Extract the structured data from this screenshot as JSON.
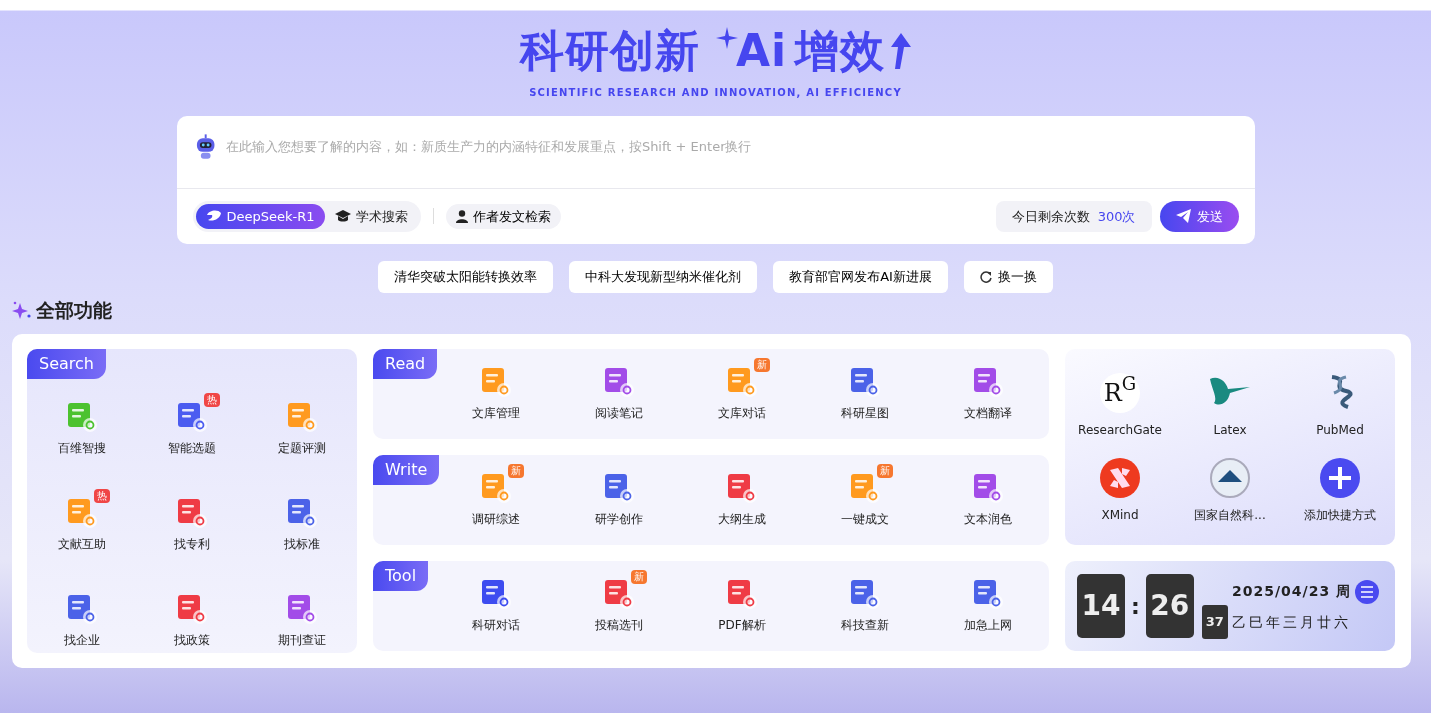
{
  "hero": {
    "title": "科研创新",
    "title_ai": "Ai",
    "title_end": "增效",
    "subtitle": "SCIENTIFIC RESEARCH AND INNOVATION, AI EFFICIENCY"
  },
  "search": {
    "placeholder": "在此输入您想要了解的内容，如：新质生产力的内涵特征和发展重点，按Shift + Enter换行",
    "modes": [
      {
        "label": "DeepSeek-R1",
        "selected": true,
        "kind": "model"
      },
      {
        "label": "学术搜索",
        "selected": false,
        "kind": "cap"
      }
    ],
    "author_search": "作者发文检索",
    "quota_label": "今日剩余次数",
    "quota_value": "300次",
    "send": "发送"
  },
  "suggestions": [
    {
      "label": "清华突破太阳能转换效率",
      "kind": "topic"
    },
    {
      "label": "中科大发现新型纳米催化剂",
      "kind": "topic"
    },
    {
      "label": "教育部官网发布AI新进展",
      "kind": "topic"
    },
    {
      "label": "换一换",
      "kind": "refresh"
    }
  ],
  "section_title": "全部功能",
  "search_group": {
    "title": "Search",
    "items": [
      {
        "label": "百维智搜",
        "color": "#4cc22f"
      },
      {
        "label": "智能选题",
        "color": "#4b5cf0",
        "badge": "热"
      },
      {
        "label": "定题评测",
        "color": "#ff9a1f"
      },
      {
        "label": "文献互助",
        "color": "#ff9a1f",
        "badge": "热"
      },
      {
        "label": "找专利",
        "color": "#ef3b45"
      },
      {
        "label": "找标准",
        "color": "#4b62e8"
      },
      {
        "label": "找企业",
        "color": "#4b62e8"
      },
      {
        "label": "找政策",
        "color": "#ef3b45"
      },
      {
        "label": "期刊查证",
        "color": "#a24ce8"
      }
    ]
  },
  "groups": [
    {
      "title": "Read",
      "items": [
        {
          "label": "文库管理",
          "color": "#ff9a1f"
        },
        {
          "label": "阅读笔记",
          "color": "#a24ce8"
        },
        {
          "label": "文库对话",
          "color": "#ff9a1f",
          "badge": "新"
        },
        {
          "label": "科研星图",
          "color": "#4b62e8"
        },
        {
          "label": "文档翻译",
          "color": "#a24ce8"
        }
      ]
    },
    {
      "title": "Write",
      "items": [
        {
          "label": "调研综述",
          "color": "#ff9a1f",
          "badge": "新"
        },
        {
          "label": "研学创作",
          "color": "#4b62e8"
        },
        {
          "label": "大纲生成",
          "color": "#ef3b45"
        },
        {
          "label": "一键成文",
          "color": "#ff9a1f",
          "badge": "新"
        },
        {
          "label": "文本润色",
          "color": "#a24ce8"
        }
      ]
    },
    {
      "title": "Tool",
      "items": [
        {
          "label": "科研对话",
          "color": "#3d4cf0"
        },
        {
          "label": "投稿选刊",
          "color": "#ef3b45",
          "badge": "新"
        },
        {
          "label": "PDF解析",
          "color": "#ef3b45"
        },
        {
          "label": "科技查新",
          "color": "#4b62e8"
        },
        {
          "label": "加急上网",
          "color": "#4b62e8"
        }
      ]
    }
  ],
  "shortcuts": [
    {
      "label": "ResearchGate",
      "kind": "rg",
      "logo": "R$^{G}$"
    },
    {
      "label": "Latex",
      "kind": "bird"
    },
    {
      "label": "PubMed",
      "kind": "helix"
    },
    {
      "label": "XMind",
      "kind": "xmind"
    },
    {
      "label": "国家自然科...",
      "kind": "seal"
    },
    {
      "label": "添加快捷方式",
      "kind": "add"
    }
  ],
  "clock": {
    "hours": "14",
    "separator": ":",
    "minutes": "26",
    "seconds": "37",
    "date": "2025/04/23 周",
    "lunar": "乙巳年三月廿六"
  }
}
